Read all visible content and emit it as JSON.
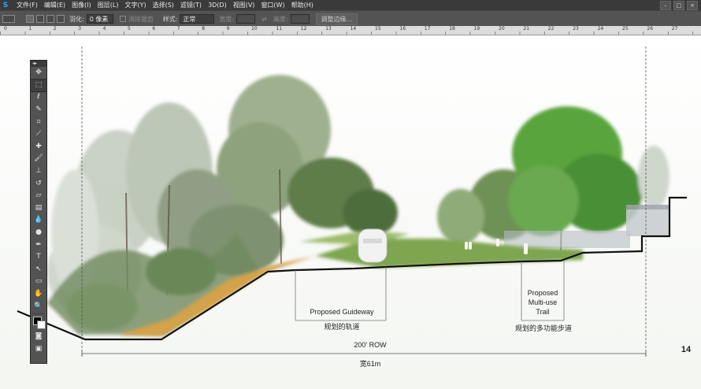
{
  "app": {
    "logo": "S"
  },
  "menu": [
    "文件(F)",
    "编辑(E)",
    "图像(I)",
    "图层(L)",
    "文字(Y)",
    "选择(S)",
    "滤镜(T)",
    "3D(D)",
    "视图(V)",
    "窗口(W)",
    "帮助(H)"
  ],
  "window_controls": [
    "–",
    "□",
    "×"
  ],
  "options_bar": {
    "feather_label": "羽化:",
    "feather_value": "0 像素",
    "antialias_label": "消除锯齿",
    "style_label": "样式:",
    "style_value": "正常",
    "width_label": "宽度:",
    "height_label": "高度:",
    "refine_edge_label": "调整边缘..."
  },
  "ruler_labels": [
    "0",
    "1",
    "2",
    "3",
    "4",
    "5",
    "6",
    "7",
    "8",
    "9",
    "10",
    "11",
    "12",
    "13",
    "14",
    "15",
    "16",
    "17",
    "18",
    "19",
    "20",
    "21",
    "22",
    "23",
    "24",
    "25",
    "26",
    "27"
  ],
  "toolbox": {
    "header": "◂▸",
    "tools": [
      {
        "name": "move-tool-icon",
        "glyph": "✥"
      },
      {
        "name": "rect-marquee-tool-icon",
        "glyph": "⬚"
      },
      {
        "name": "lasso-tool-icon",
        "glyph": "ℓ"
      },
      {
        "name": "quick-select-tool-icon",
        "glyph": "✎"
      },
      {
        "name": "crop-tool-icon",
        "glyph": "⌗"
      },
      {
        "name": "eyedropper-tool-icon",
        "glyph": "⟋"
      },
      {
        "name": "healing-brush-tool-icon",
        "glyph": "✚"
      },
      {
        "name": "brush-tool-icon",
        "glyph": "🖌"
      },
      {
        "name": "clone-stamp-tool-icon",
        "glyph": "⊥"
      },
      {
        "name": "history-brush-tool-icon",
        "glyph": "↺"
      },
      {
        "name": "eraser-tool-icon",
        "glyph": "▱"
      },
      {
        "name": "gradient-tool-icon",
        "glyph": "▤"
      },
      {
        "name": "blur-tool-icon",
        "glyph": "💧"
      },
      {
        "name": "dodge-tool-icon",
        "glyph": "●"
      },
      {
        "name": "pen-tool-icon",
        "glyph": "✒"
      },
      {
        "name": "type-tool-icon",
        "glyph": "T"
      },
      {
        "name": "path-select-tool-icon",
        "glyph": "↖"
      },
      {
        "name": "rectangle-tool-icon",
        "glyph": "▭"
      },
      {
        "name": "hand-tool-icon",
        "glyph": "✋"
      },
      {
        "name": "zoom-tool-icon",
        "glyph": "🔍"
      }
    ],
    "extra": [
      {
        "name": "quick-mask-icon",
        "glyph": "◙"
      },
      {
        "name": "screen-mode-icon",
        "glyph": "▣"
      }
    ]
  },
  "canvas": {
    "labels": {
      "guideway_en": "Proposed Guideway",
      "guideway_cn": "规划的轨道",
      "trail_en_1": "Proposed",
      "trail_en_2": "Multi-use",
      "trail_en_3": "Trail",
      "trail_cn": "规划的多功能步道",
      "row_en": "200' ROW",
      "row_cn": "宽61m",
      "page_number": "14"
    }
  }
}
